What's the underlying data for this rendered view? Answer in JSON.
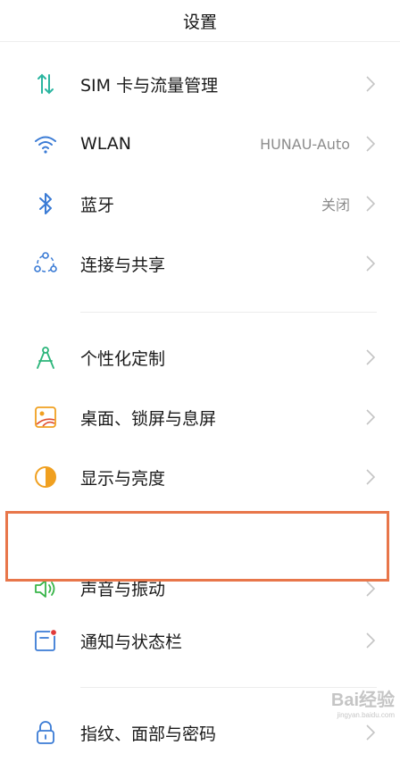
{
  "header": {
    "title": "设置"
  },
  "items": [
    {
      "label": "SIM 卡与流量管理",
      "value": ""
    },
    {
      "label": "WLAN",
      "value": "HUNAU-Auto"
    },
    {
      "label": "蓝牙",
      "value": "关闭"
    },
    {
      "label": "连接与共享",
      "value": ""
    },
    {
      "label": "个性化定制",
      "value": ""
    },
    {
      "label": "桌面、锁屏与息屏",
      "value": ""
    },
    {
      "label": "显示与亮度",
      "value": ""
    },
    {
      "label": "声音与振动",
      "value": ""
    },
    {
      "label": "通知与状态栏",
      "value": ""
    },
    {
      "label": "指纹、面部与密码",
      "value": ""
    }
  ],
  "icons": [
    "sim-data-icon",
    "wifi-icon",
    "bluetooth-icon",
    "share-icon",
    "personalize-icon",
    "wallpaper-icon",
    "display-icon",
    "sound-icon",
    "notification-icon",
    "lock-icon"
  ],
  "colors": {
    "highlight": "#e8764a",
    "sim": "#2bb5a0",
    "wifi": "#3a7bd5",
    "personalize": "#2bb57a",
    "wallpaper": "#f0a020",
    "display": "#f0a020",
    "sound": "#39b54a",
    "notification": "#e03a3a",
    "lock": "#3a7bd5"
  },
  "watermark": {
    "text": "Bai",
    "suffix": "经验",
    "url": "jingyan.baidu.com"
  }
}
